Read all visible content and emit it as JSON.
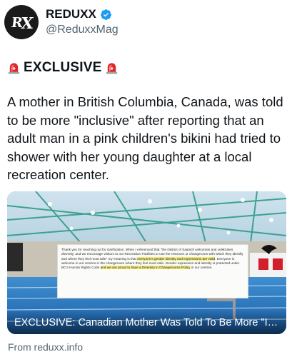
{
  "account": {
    "display_name": "REDUXX",
    "handle": "@ReduxxMag",
    "avatar_mark_left": "R",
    "avatar_mark_right": "X",
    "verified": true,
    "verified_color": "#1d9bf0"
  },
  "tweet": {
    "label": "EXCLUSIVE",
    "label_icon": "police-siren-icon",
    "text": "A mother in British Columbia, Canada, was told to be more \"inclusive\" after reporting that an adult man in a pink children's bikini had tried to shower with her young daughter at a local recreation center."
  },
  "media": {
    "caption": "EXCLUSIVE: Canadian Mother Was Told To Be More \"Inclusive\"...",
    "email_parts": [
      {
        "text": "Thank you for reaching out for clarification. When I referenced that \"the District of Saanich welcomes and celebrates diversity, and we encourage visitors to our Recreation Facilities to use the restroom or changeroom with which they identify and where they feel most safe\" my meaning is that ",
        "highlight": false
      },
      {
        "text": "everyone's gender identity and expressions are valid",
        "highlight": true
      },
      {
        "text": ". Everyone is welcome in our centres in the changeroom where they feel most safe. Gender expression and identity is protected under BC's Human Rights Code ",
        "highlight": false
      },
      {
        "text": "and we are proud to have a Diversity in Changerooms Policy",
        "highlight": true
      },
      {
        "text": " in our centres.",
        "highlight": false
      }
    ]
  },
  "source": {
    "text": "From reduxx.info"
  }
}
